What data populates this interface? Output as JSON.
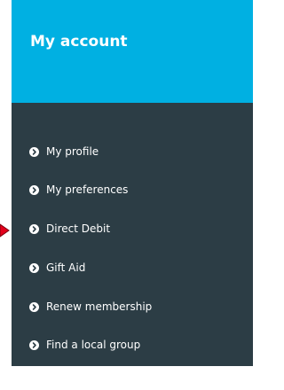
{
  "account_panel": {
    "title": "My account",
    "items": [
      {
        "label": "My profile",
        "icon": "chevron-right-circle-icon"
      },
      {
        "label": "My preferences",
        "icon": "chevron-right-circle-icon"
      },
      {
        "label": "Direct Debit",
        "icon": "chevron-right-circle-icon"
      },
      {
        "label": "Gift Aid",
        "icon": "chevron-right-circle-icon"
      },
      {
        "label": "Renew membership",
        "icon": "chevron-right-circle-icon"
      },
      {
        "label": "Find a local group",
        "icon": "chevron-right-circle-icon"
      }
    ]
  },
  "annotation": {
    "icon": "red-pointer-arrow-icon"
  },
  "colors": {
    "header": "#00b0e2",
    "panel": "#2c3d45",
    "text": "#ffffff",
    "pointer": "#e3001b"
  }
}
